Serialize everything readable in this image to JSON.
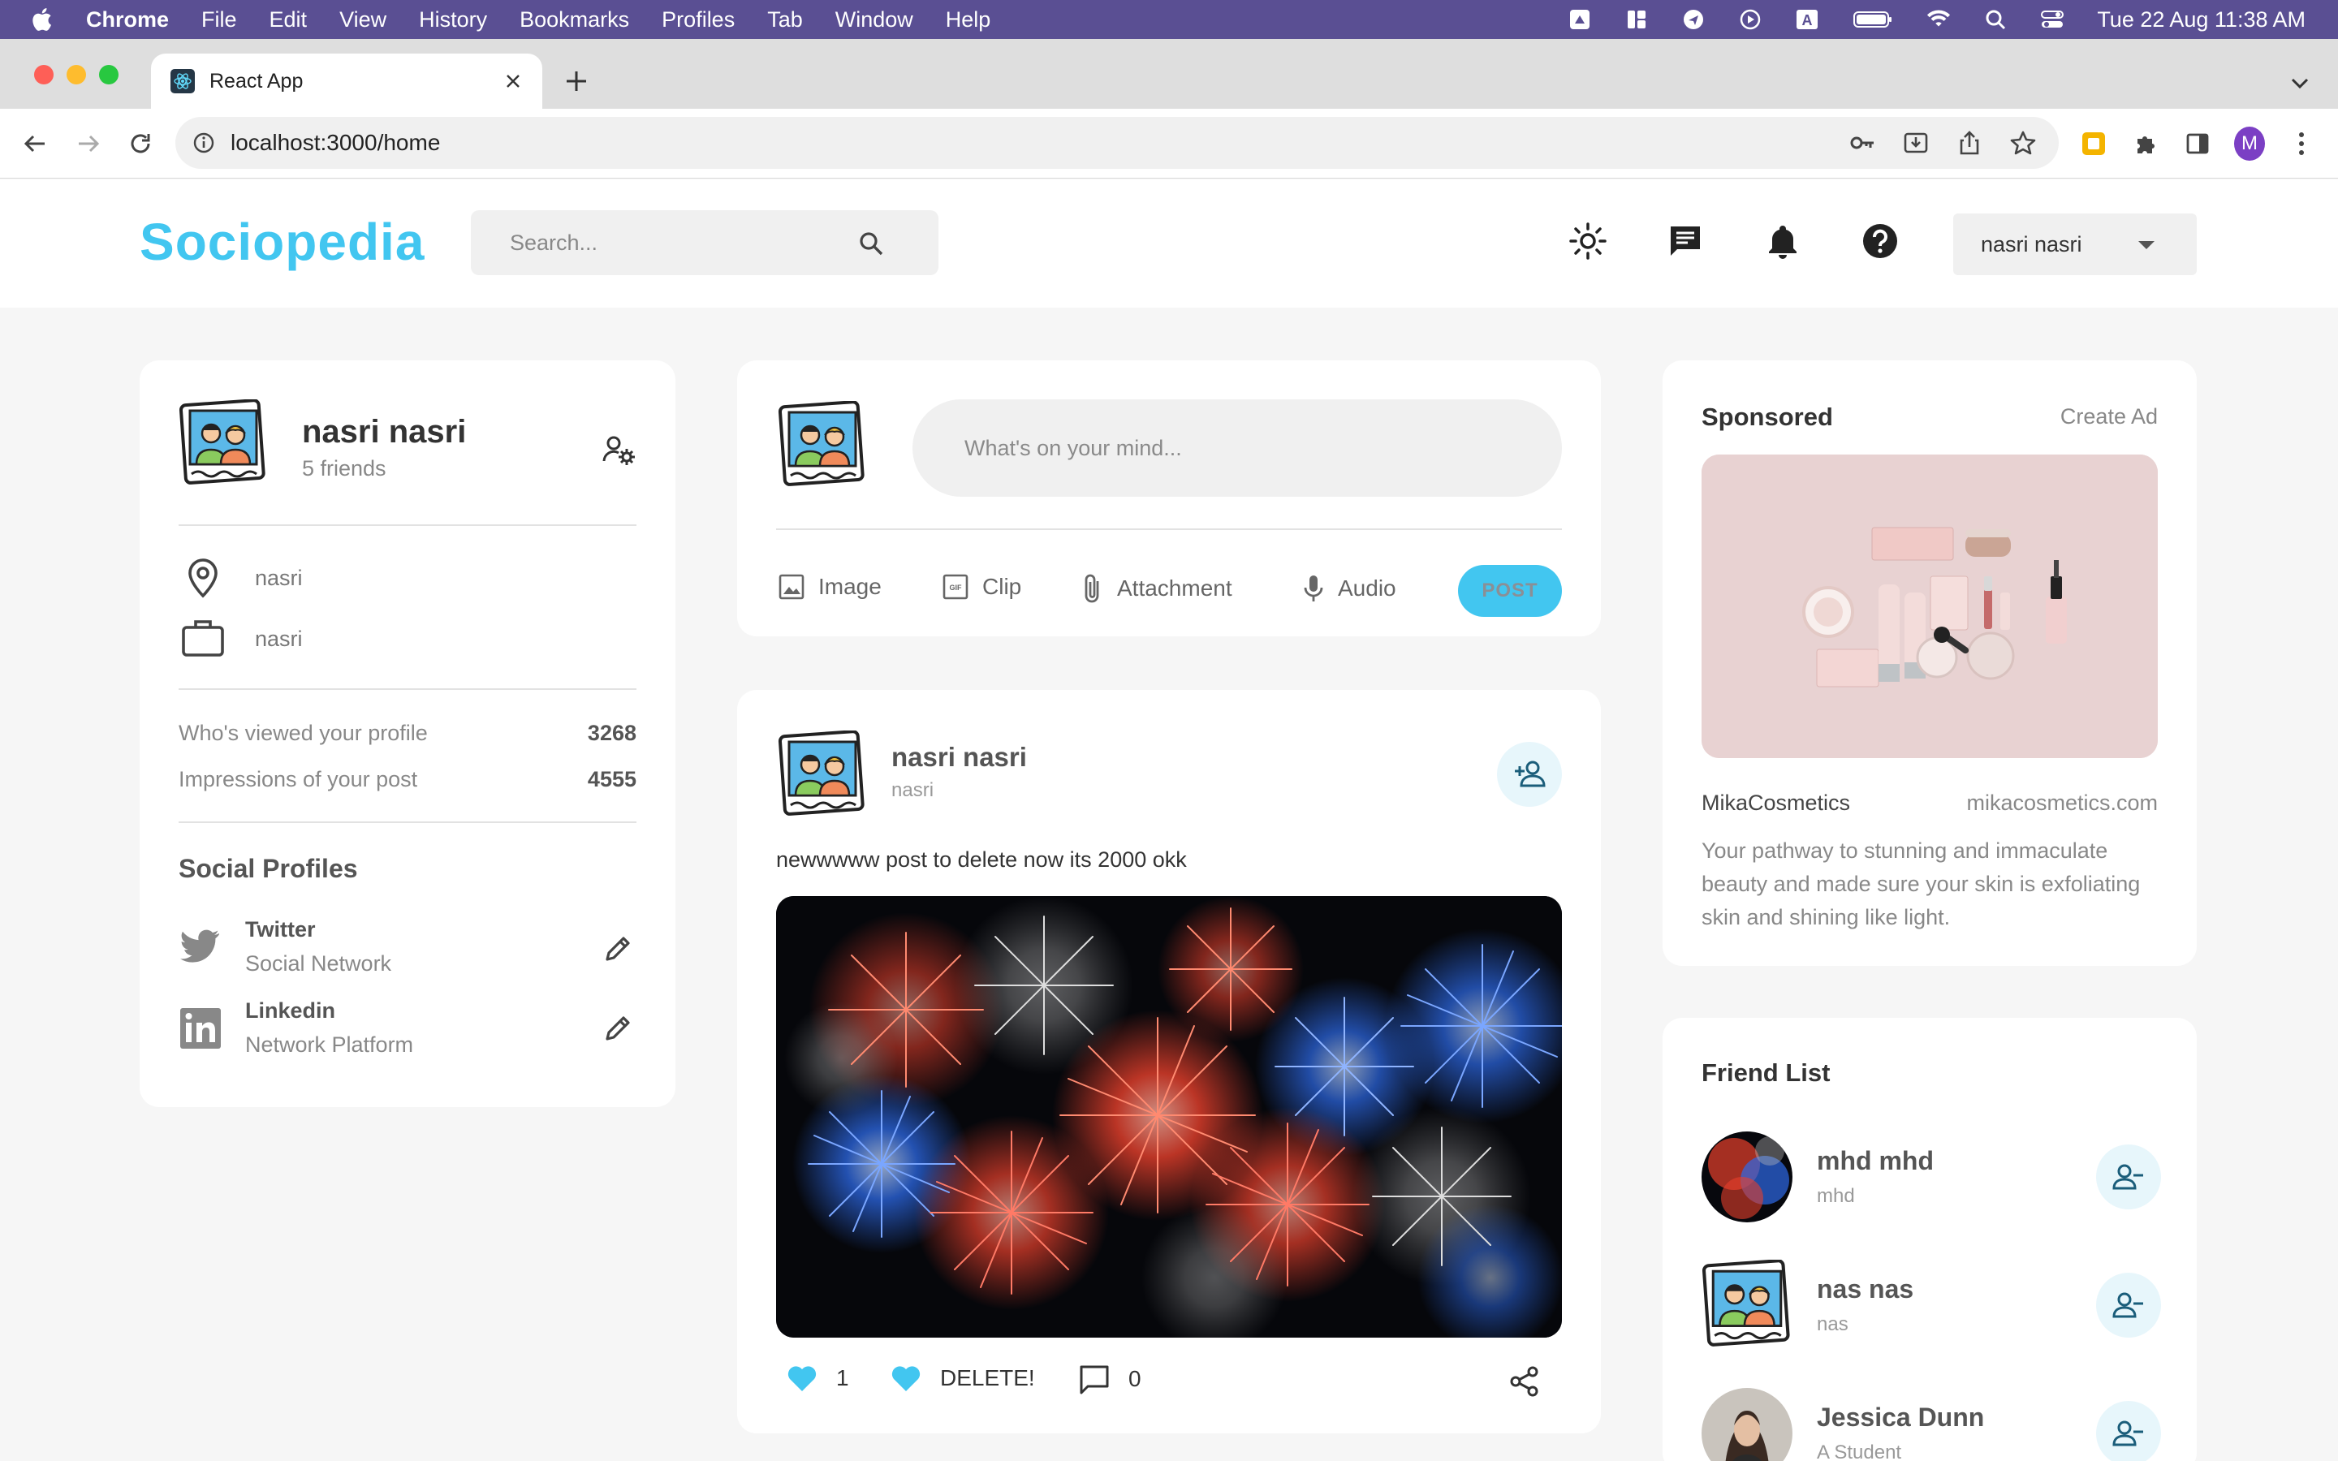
{
  "menubar": {
    "app": "Chrome",
    "items": [
      "File",
      "Edit",
      "View",
      "History",
      "Bookmarks",
      "Profiles",
      "Tab",
      "Window",
      "Help"
    ],
    "clock": "Tue 22 Aug  11:38 AM"
  },
  "browser": {
    "tab_title": "React App",
    "url": "localhost:3000/home",
    "profile_initial": "M"
  },
  "navbar": {
    "logo": "Sociopedia",
    "search_placeholder": "Search...",
    "user_name": "nasri nasri"
  },
  "user_widget": {
    "name": "nasri nasri",
    "friends": "5 friends",
    "location": "nasri",
    "occupation": "nasri",
    "stats": [
      {
        "label": "Who's viewed your profile",
        "value": "3268"
      },
      {
        "label": "Impressions of your post",
        "value": "4555"
      }
    ],
    "social_title": "Social Profiles",
    "socials": [
      {
        "name": "Twitter",
        "sub": "Social Network",
        "icon": "twitter-icon"
      },
      {
        "name": "Linkedin",
        "sub": "Network Platform",
        "icon": "linkedin-icon"
      }
    ]
  },
  "composer": {
    "placeholder": "What's on your mind...",
    "actions": [
      "Image",
      "Clip",
      "Attachment",
      "Audio"
    ],
    "post_label": "POST"
  },
  "post": {
    "name": "nasri nasri",
    "location": "nasri",
    "description": "newwwww post to delete now its 2000 okk",
    "likes": "1",
    "delete_label": "DELETE!",
    "comments": "0"
  },
  "sponsored": {
    "title": "Sponsored",
    "create": "Create Ad",
    "brand": "MikaCosmetics",
    "site": "mikacosmetics.com",
    "description": "Your pathway to stunning and immaculate beauty and made sure your skin is exfoliating skin and shining like light."
  },
  "friend_list": {
    "title": "Friend List",
    "friends": [
      {
        "name": "mhd mhd",
        "sub": "mhd"
      },
      {
        "name": "nas nas",
        "sub": "nas"
      },
      {
        "name": "Jessica Dunn",
        "sub": "A Student"
      }
    ]
  },
  "colors": {
    "primary": "#42c6f0",
    "menubar": "#5a4f93",
    "background": "#f6f6f6"
  }
}
